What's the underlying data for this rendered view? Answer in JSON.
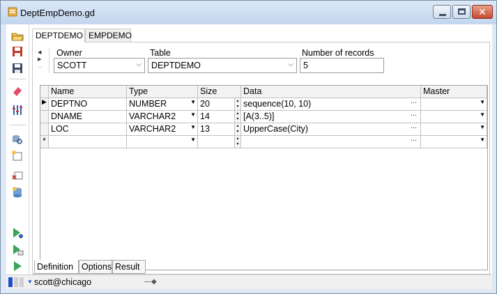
{
  "window": {
    "title": "DeptEmpDemo.gd"
  },
  "top_tabs": [
    "DEPTDEMO",
    "EMPDEMO"
  ],
  "header": {
    "owner_label": "Owner",
    "owner_value": "SCOTT",
    "table_label": "Table",
    "table_value": "DEPTDEMO",
    "records_label": "Number of records",
    "records_value": "5"
  },
  "grid": {
    "columns": [
      "Name",
      "Type",
      "Size",
      "Data",
      "Master"
    ],
    "rows": [
      {
        "name": "DEPTNO",
        "type": "NUMBER",
        "size": "20",
        "data": "sequence(10, 10)",
        "master": ""
      },
      {
        "name": "DNAME",
        "type": "VARCHAR2",
        "size": "14",
        "data": "[A(3..5)]",
        "master": ""
      },
      {
        "name": "LOC",
        "type": "VARCHAR2",
        "size": "13",
        "data": "UpperCase(City)",
        "master": ""
      }
    ],
    "new_row_marker": "*",
    "current_row_marker": "▶",
    "ellipsis": "..."
  },
  "bottom_tabs": [
    "Definition",
    "Options",
    "Result"
  ],
  "status": {
    "connection": "scott@chicago"
  },
  "colors": {
    "accent": "#1f4fcf",
    "title_bg": "#c3d6ee",
    "close": "#c64a2e"
  }
}
